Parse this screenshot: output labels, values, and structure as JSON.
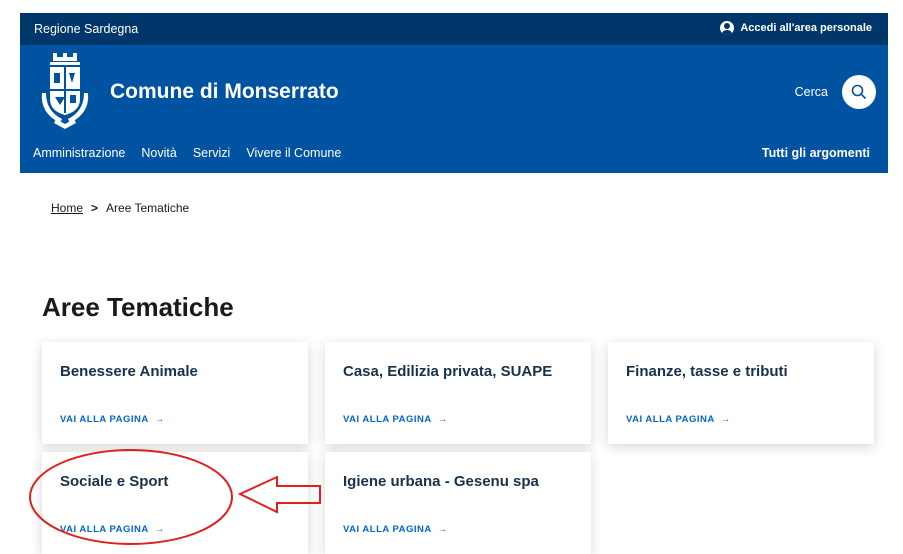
{
  "header": {
    "region": "Regione Sardegna",
    "login_label": "Accedi all'area personale",
    "site_title": "Comune di Monserrato",
    "search_label": "Cerca"
  },
  "nav": {
    "items": [
      {
        "label": "Amministrazione"
      },
      {
        "label": "Novità"
      },
      {
        "label": "Servizi"
      },
      {
        "label": "Vivere il Comune"
      }
    ],
    "all_topics": "Tutti gli argomenti"
  },
  "breadcrumb": {
    "home": "Home",
    "separator": ">",
    "current": "Aree Tematiche"
  },
  "page_title": "Aree Tematiche",
  "cards": [
    {
      "title": "Benessere Animale",
      "link": "VAI ALLA PAGINA"
    },
    {
      "title": "Casa, Edilizia privata, SUAPE",
      "link": "VAI ALLA PAGINA"
    },
    {
      "title": "Finanze, tasse e tributi",
      "link": "VAI ALLA PAGINA"
    },
    {
      "title": "Sociale e Sport",
      "link": "VAI ALLA PAGINA"
    },
    {
      "title": "Igiene urbana - Gesenu spa",
      "link": "VAI ALLA PAGINA"
    }
  ],
  "colors": {
    "slim_header": "#00376b",
    "header": "#0053a0",
    "card_title": "#17324d",
    "link": "#0066cc",
    "annotation": "#e0201f"
  }
}
